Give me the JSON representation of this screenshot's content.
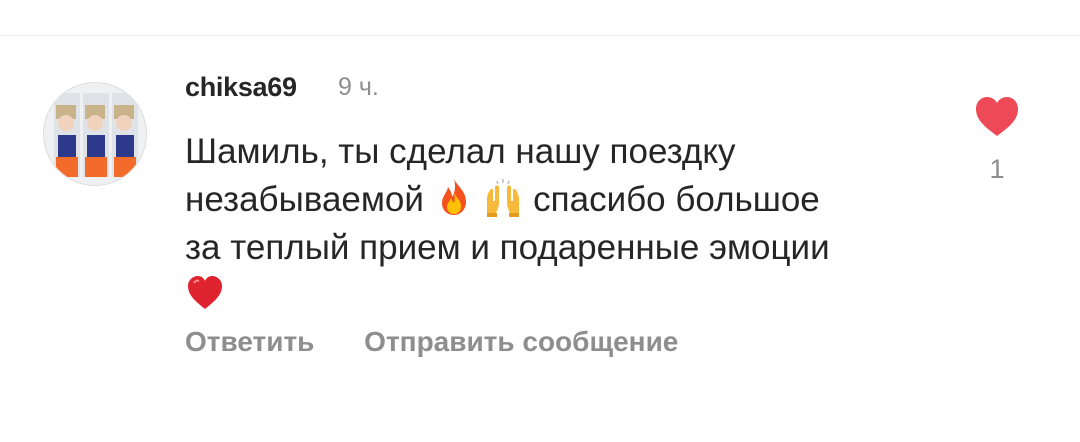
{
  "comment": {
    "username": "chiksa69",
    "timestamp": "9 ч.",
    "text_lines": [
      "Шамиль, ты сделал нашу поездку",
      "незабываемой",
      "спасибо большое",
      "за теплый прием и подаренные эмоции"
    ],
    "emojis": {
      "fire": "fire-icon",
      "raised_hands": "raised-hands-icon",
      "heart": "red-heart-icon"
    },
    "like_count": "1",
    "liked": true,
    "actions": {
      "reply_label": "Ответить",
      "send_message_label": "Отправить сообщение"
    }
  },
  "colors": {
    "like_red": "#ed4956",
    "secondary_text": "#8e8e8e",
    "primary_text": "#262626"
  }
}
